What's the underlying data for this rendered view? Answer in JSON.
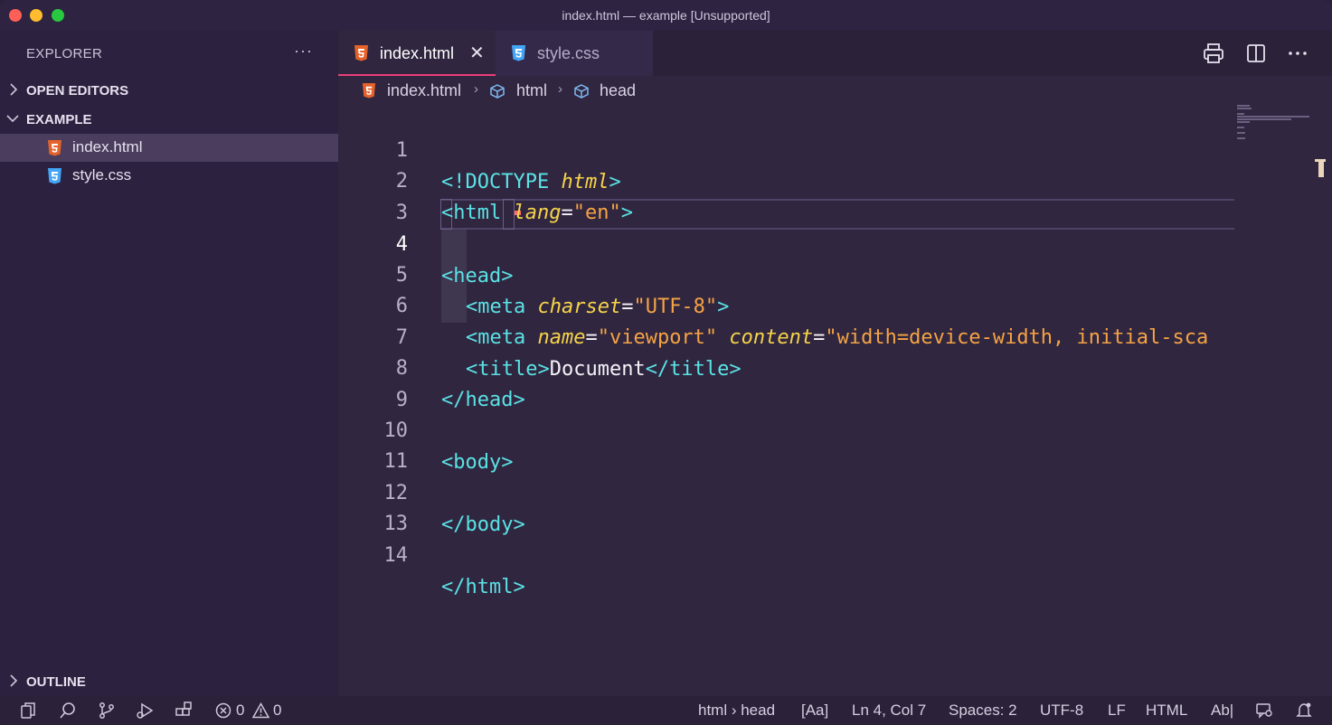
{
  "window": {
    "title": "index.html — example [Unsupported]"
  },
  "sidebar": {
    "header": "EXPLORER",
    "more_label": "···",
    "sections": {
      "open_editors": "OPEN EDITORS",
      "example": "EXAMPLE",
      "outline": "OUTLINE"
    },
    "files": [
      {
        "name": "index.html",
        "icon": "html5-icon",
        "active": true
      },
      {
        "name": "style.css",
        "icon": "css3-icon",
        "active": false
      }
    ]
  },
  "tabs": [
    {
      "label": "index.html",
      "icon": "html5-icon",
      "active": true,
      "close": "✕"
    },
    {
      "label": "style.css",
      "icon": "css3-icon",
      "active": false
    }
  ],
  "breadcrumb": {
    "file": "index.html",
    "items": [
      "html",
      "head"
    ]
  },
  "editor": {
    "current_line": 4,
    "lines": [
      {
        "n": "1"
      },
      {
        "n": "2"
      },
      {
        "n": "3"
      },
      {
        "n": "4"
      },
      {
        "n": "5"
      },
      {
        "n": "6"
      },
      {
        "n": "7"
      },
      {
        "n": "8"
      },
      {
        "n": "9"
      },
      {
        "n": "10"
      },
      {
        "n": "11"
      },
      {
        "n": "12"
      },
      {
        "n": "13"
      },
      {
        "n": "14"
      }
    ],
    "tokens": {
      "l1a": "<!DOCTYPE ",
      "l1b": "html",
      "l1c": ">",
      "l2a": "<html ",
      "l2b": "lang",
      "l2c": "=",
      "l2d": "\"en\"",
      "l2e": ">",
      "l4a": "<head>",
      "l5a": "<meta ",
      "l5b": "charset",
      "l5c": "=",
      "l5d": "\"UTF-8\"",
      "l5e": ">",
      "l6a": "<meta ",
      "l6b": "name",
      "l6c": "=",
      "l6d": "\"viewport\" ",
      "l6e": "content",
      "l6f": "=",
      "l6g": "\"width=device-width, initial-sca",
      "l7a": "<title>",
      "l7b": "Document",
      "l7c": "</title>",
      "l8a": "</head>",
      "l10a": "<body>",
      "l12a": "</body>",
      "l14a": "</html>"
    }
  },
  "status": {
    "errors": "0",
    "warnings": "0",
    "breadcrumb": "html › head",
    "case": "[Aa]",
    "position": "Ln 4, Col 7",
    "spaces": "Spaces: 2",
    "encoding": "UTF-8",
    "eol": "LF",
    "language": "HTML",
    "ab": "Ab|"
  },
  "colors": {
    "accent_tab_border": "#e93f79",
    "tag": "#5be2e5",
    "attribute": "#f6d34a",
    "string": "#f5a344"
  }
}
